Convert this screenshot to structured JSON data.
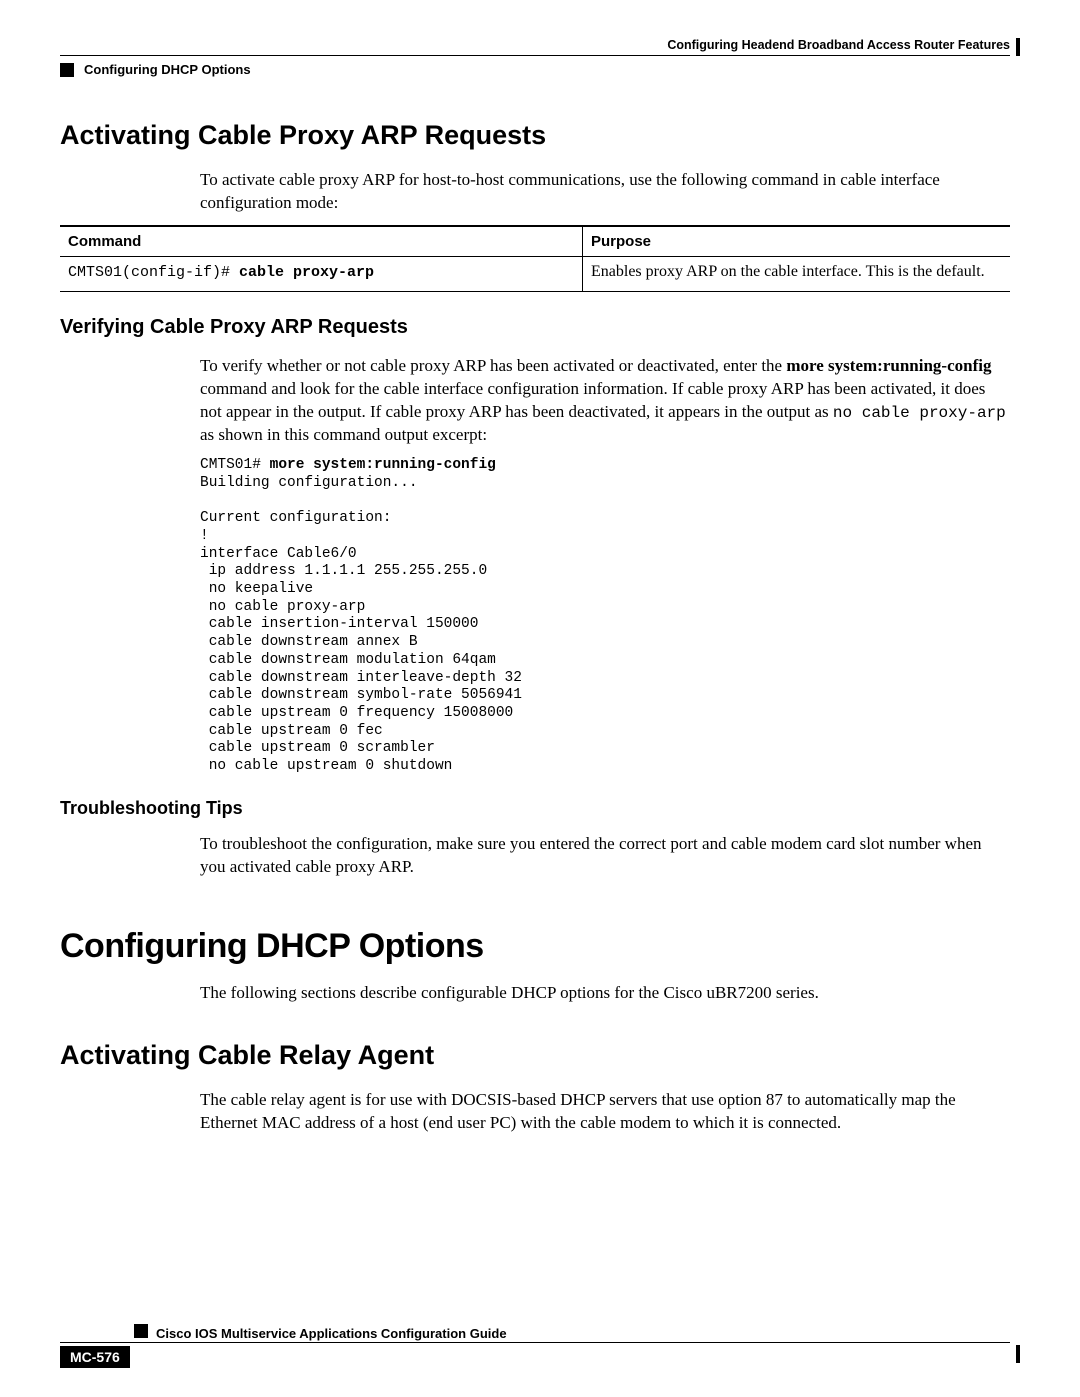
{
  "header": {
    "chapter": "Configuring Headend Broadband Access Router Features",
    "section": "Configuring DHCP Options"
  },
  "s1": {
    "h": "Activating Cable Proxy ARP Requests",
    "p1": "To activate cable proxy ARP for host-to-host communications, use the following command in cable interface configuration mode:"
  },
  "table1": {
    "th_cmd": "Command",
    "th_purp": "Purpose",
    "cmd_prefix": "CMTS01(config-if)# ",
    "cmd_bold": "cable proxy-arp",
    "purpose": "Enables proxy ARP on the cable interface. This is the default."
  },
  "s2": {
    "h": "Verifying Cable Proxy ARP Requests",
    "p1_a": "To verify whether or not cable proxy ARP has been activated or deactivated, enter the ",
    "p1_b": "more system:running-config",
    "p1_c": " command and look for the cable interface configuration information. If cable proxy ARP has been activated, it does not appear in the output. If cable proxy ARP has been deactivated, it appears in the output as ",
    "p1_mono": "no cable proxy-arp",
    "p1_d": " as shown in this command output excerpt:"
  },
  "code1": {
    "line0_prompt": "CMTS01# ",
    "line0_cmd": "more system:running-config",
    "body": "Building configuration...\n\nCurrent configuration:\n!\ninterface Cable6/0\n ip address 1.1.1.1 255.255.255.0\n no keepalive\n no cable proxy-arp\n cable insertion-interval 150000\n cable downstream annex B\n cable downstream modulation 64qam\n cable downstream interleave-depth 32\n cable downstream symbol-rate 5056941\n cable upstream 0 frequency 15008000\n cable upstream 0 fec\n cable upstream 0 scrambler\n no cable upstream 0 shutdown"
  },
  "s3": {
    "h": "Troubleshooting Tips",
    "p1": "To troubleshoot the configuration, make sure you entered the correct port and cable modem card slot number when you activated cable proxy ARP."
  },
  "s4": {
    "h": "Configuring DHCP Options",
    "p1": "The following sections describe configurable DHCP options for the Cisco uBR7200 series."
  },
  "s5": {
    "h": "Activating Cable Relay Agent",
    "p1": "The cable relay agent is for use with DOCSIS-based DHCP servers that use option 87 to automatically map the Ethernet MAC address of a host (end user PC) with the cable modem to which it is connected."
  },
  "footer": {
    "guide": "Cisco IOS Multiservice Applications Configuration Guide",
    "page": "MC-576"
  }
}
